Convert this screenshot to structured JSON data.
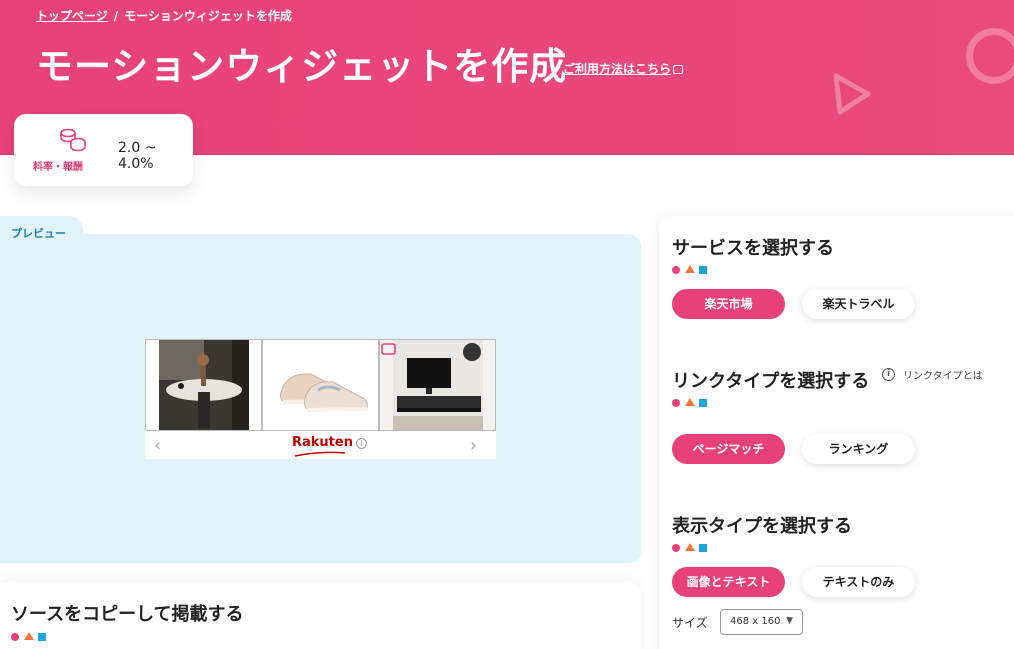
{
  "breadcrumb": {
    "home": "トップページ",
    "separator": "/",
    "current": "モーションウィジェットを作成"
  },
  "header": {
    "title": "モーションウィジェットを作成",
    "help_link": "ご利用方法はこちら"
  },
  "rate_card": {
    "icon": "coins-icon",
    "label": "料率・報酬",
    "value": "2.0 ~ 4.0%"
  },
  "preview": {
    "label": "プレビュー",
    "widget": {
      "products": [
        "round-coffee-table",
        "beige-sneakers",
        "tv-stand"
      ],
      "prev_arrow": "‹",
      "next_arrow": "›",
      "logo": "Rakuten",
      "info": "i"
    }
  },
  "copy_section": {
    "title": "ソースをコピーして掲載する"
  },
  "service_section": {
    "title": "サービスを選択する",
    "options": [
      {
        "label": "楽天市場",
        "selected": true
      },
      {
        "label": "楽天トラベル",
        "selected": false
      }
    ]
  },
  "link_type_section": {
    "title": "リンクタイプを選択する",
    "info_text": "リンクタイプとは",
    "options": [
      {
        "label": "ページマッチ",
        "selected": true
      },
      {
        "label": "ランキング",
        "selected": false
      }
    ]
  },
  "display_type_section": {
    "title": "表示タイプを選択する",
    "options": [
      {
        "label": "画像とテキスト",
        "selected": true
      },
      {
        "label": "テキストのみ",
        "selected": false
      }
    ],
    "size_label": "サイズ",
    "size_value": "468 x 160",
    "size_caret": "▼"
  },
  "colors": {
    "brand_pink": "#e8417a",
    "preview_bg": "#e1f4fb",
    "accent_orange": "#f07a3e",
    "accent_blue": "#1aa6d9"
  }
}
